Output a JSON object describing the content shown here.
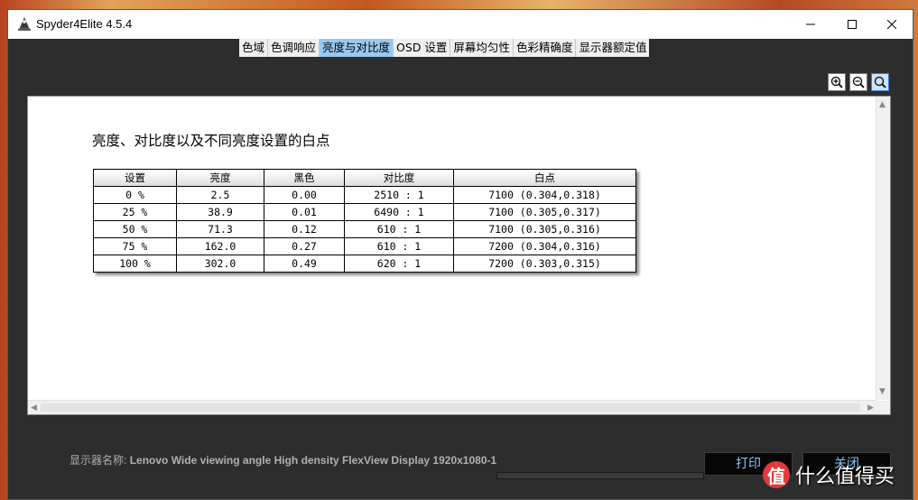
{
  "window": {
    "title": "Spyder4Elite 4.5.4",
    "controls": {
      "minimize": "minimize-icon",
      "maximize": "maximize-icon",
      "close": "close-icon"
    }
  },
  "tabs": [
    {
      "label": "色域",
      "active": false
    },
    {
      "label": "色调响应",
      "active": false
    },
    {
      "label": "亮度与对比度",
      "active": true
    },
    {
      "label": "OSD 设置",
      "active": false
    },
    {
      "label": "屏幕均匀性",
      "active": false
    },
    {
      "label": "色彩精确度",
      "active": false
    },
    {
      "label": "显示器额定值",
      "active": false
    }
  ],
  "zoom": {
    "zoom_in": "zoom-in-icon",
    "zoom_out": "zoom-out-icon",
    "zoom_fit": "zoom-fit-icon"
  },
  "report": {
    "title": "亮度、对比度以及不同亮度设置的白点",
    "table": {
      "headers": [
        "设置",
        "亮度",
        "黑色",
        "对比度",
        "白点"
      ],
      "rows": [
        [
          "0 %",
          "2.5",
          "0.00",
          "2510 : 1",
          "7100 (0.304,0.318)"
        ],
        [
          "25 %",
          "38.9",
          "0.01",
          "6490 : 1",
          "7100 (0.305,0.317)"
        ],
        [
          "50 %",
          "71.3",
          "0.12",
          "610 : 1",
          "7100 (0.305,0.316)"
        ],
        [
          "75 %",
          "162.0",
          "0.27",
          "610 : 1",
          "7200 (0.304,0.316)"
        ],
        [
          "100 %",
          "302.0",
          "0.49",
          "620 : 1",
          "7200 (0.303,0.315)"
        ]
      ]
    }
  },
  "footer": {
    "display_label": "显示器名称:",
    "display_name": "Lenovo Wide viewing angle  High density FlexView Display 1920x1080-1",
    "print_button": "打印",
    "close_button": "关闭"
  },
  "watermark": {
    "circle": "值",
    "text": "什么值得买"
  },
  "colors": {
    "active_tab": "#99c9ef",
    "button_text": "#8cc3f5",
    "window_bg": "#2d2d2d"
  }
}
